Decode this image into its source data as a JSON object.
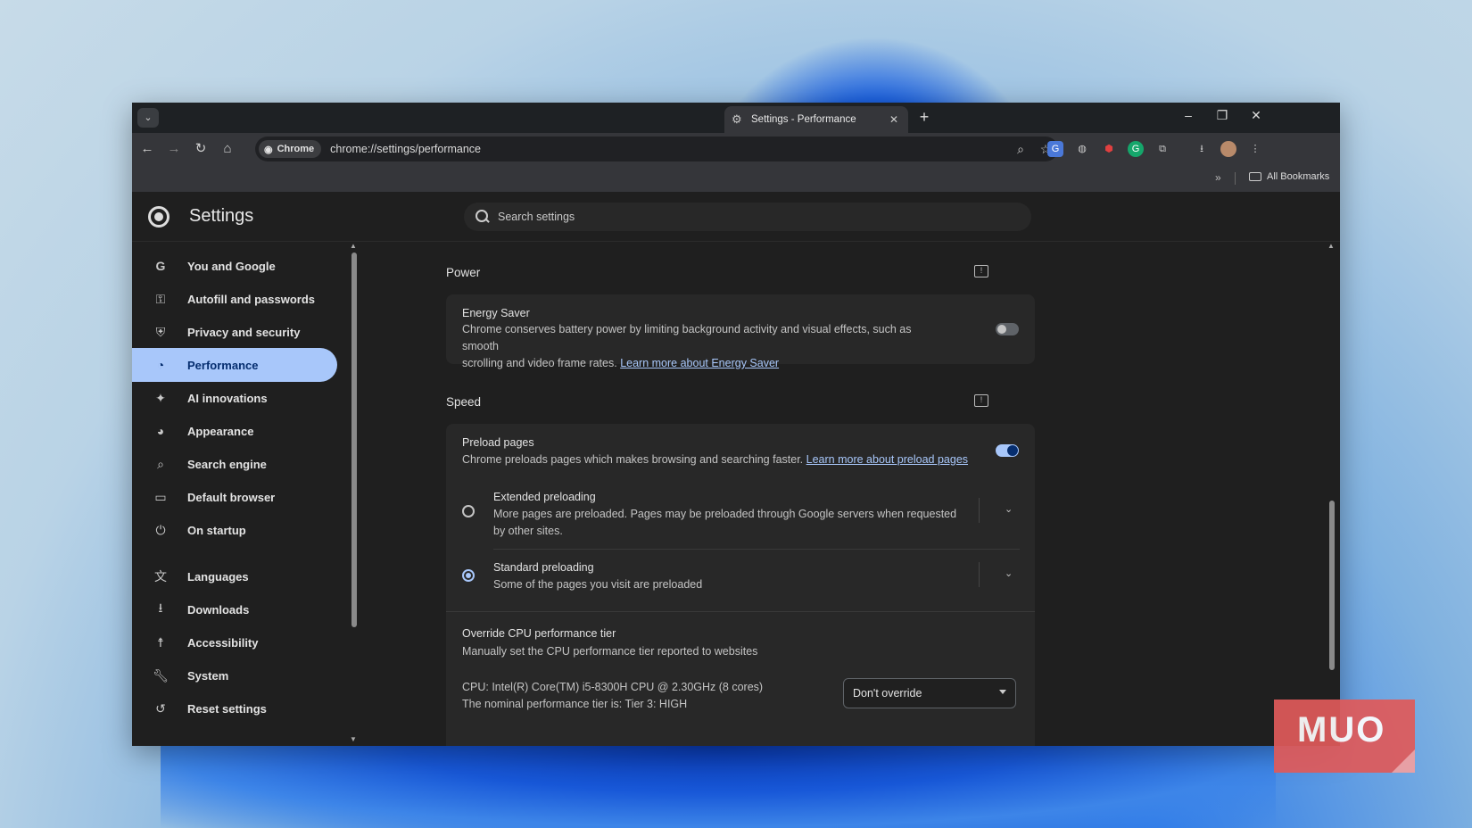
{
  "tab": {
    "title": "Settings - Performance"
  },
  "toolbar": {
    "chip_label": "Chrome",
    "url": "chrome://settings/performance"
  },
  "bookmarks": {
    "all_label": "All Bookmarks"
  },
  "settings": {
    "title": "Settings",
    "search_placeholder": "Search settings"
  },
  "sidebar": {
    "items": [
      {
        "label": "You and Google",
        "icon": "google-g-icon"
      },
      {
        "label": "Autofill and passwords",
        "icon": "key-icon"
      },
      {
        "label": "Privacy and security",
        "icon": "shield-icon"
      },
      {
        "label": "Performance",
        "icon": "speedometer-icon",
        "active": true
      },
      {
        "label": "AI innovations",
        "icon": "sparkle-icon"
      },
      {
        "label": "Appearance",
        "icon": "palette-icon"
      },
      {
        "label": "Search engine",
        "icon": "search-icon"
      },
      {
        "label": "Default browser",
        "icon": "browser-window-icon"
      },
      {
        "label": "On startup",
        "icon": "power-icon"
      },
      {
        "label": "Languages",
        "icon": "translate-icon"
      },
      {
        "label": "Downloads",
        "icon": "download-icon"
      },
      {
        "label": "Accessibility",
        "icon": "accessibility-icon"
      },
      {
        "label": "System",
        "icon": "wrench-icon"
      },
      {
        "label": "Reset settings",
        "icon": "reset-icon"
      }
    ]
  },
  "power": {
    "title": "Power",
    "energy_saver": {
      "title": "Energy Saver",
      "desc_line1": "Chrome conserves battery power by limiting background activity and visual effects, such as smooth",
      "desc_line2": "scrolling and video frame rates.",
      "link": "Learn more about Energy Saver",
      "enabled": false
    }
  },
  "speed": {
    "title": "Speed",
    "preload": {
      "title": "Preload pages",
      "desc": "Chrome preloads pages which makes browsing and searching faster.",
      "link": "Learn more about preload pages",
      "enabled": true
    },
    "extended": {
      "title": "Extended preloading",
      "desc_line1": "More pages are preloaded. Pages may be preloaded through Google servers when requested",
      "desc_line2": "by other sites.",
      "selected": false
    },
    "standard": {
      "title": "Standard preloading",
      "desc": "Some of the pages you visit are preloaded",
      "selected": true
    },
    "cpu": {
      "title": "Override CPU performance tier",
      "desc": "Manually set the CPU performance tier reported to websites",
      "cpu_line": "CPU: Intel(R) Core(TM) i5-8300H CPU @ 2.30GHz (8 cores)",
      "tier_line": "The nominal performance tier is: Tier 3: HIGH",
      "select_value": "Don't override"
    }
  },
  "watermark": {
    "text": "MUO"
  },
  "colors": {
    "accent": "#a8c7fa",
    "background": "#1f1f1f",
    "card": "#282828"
  }
}
